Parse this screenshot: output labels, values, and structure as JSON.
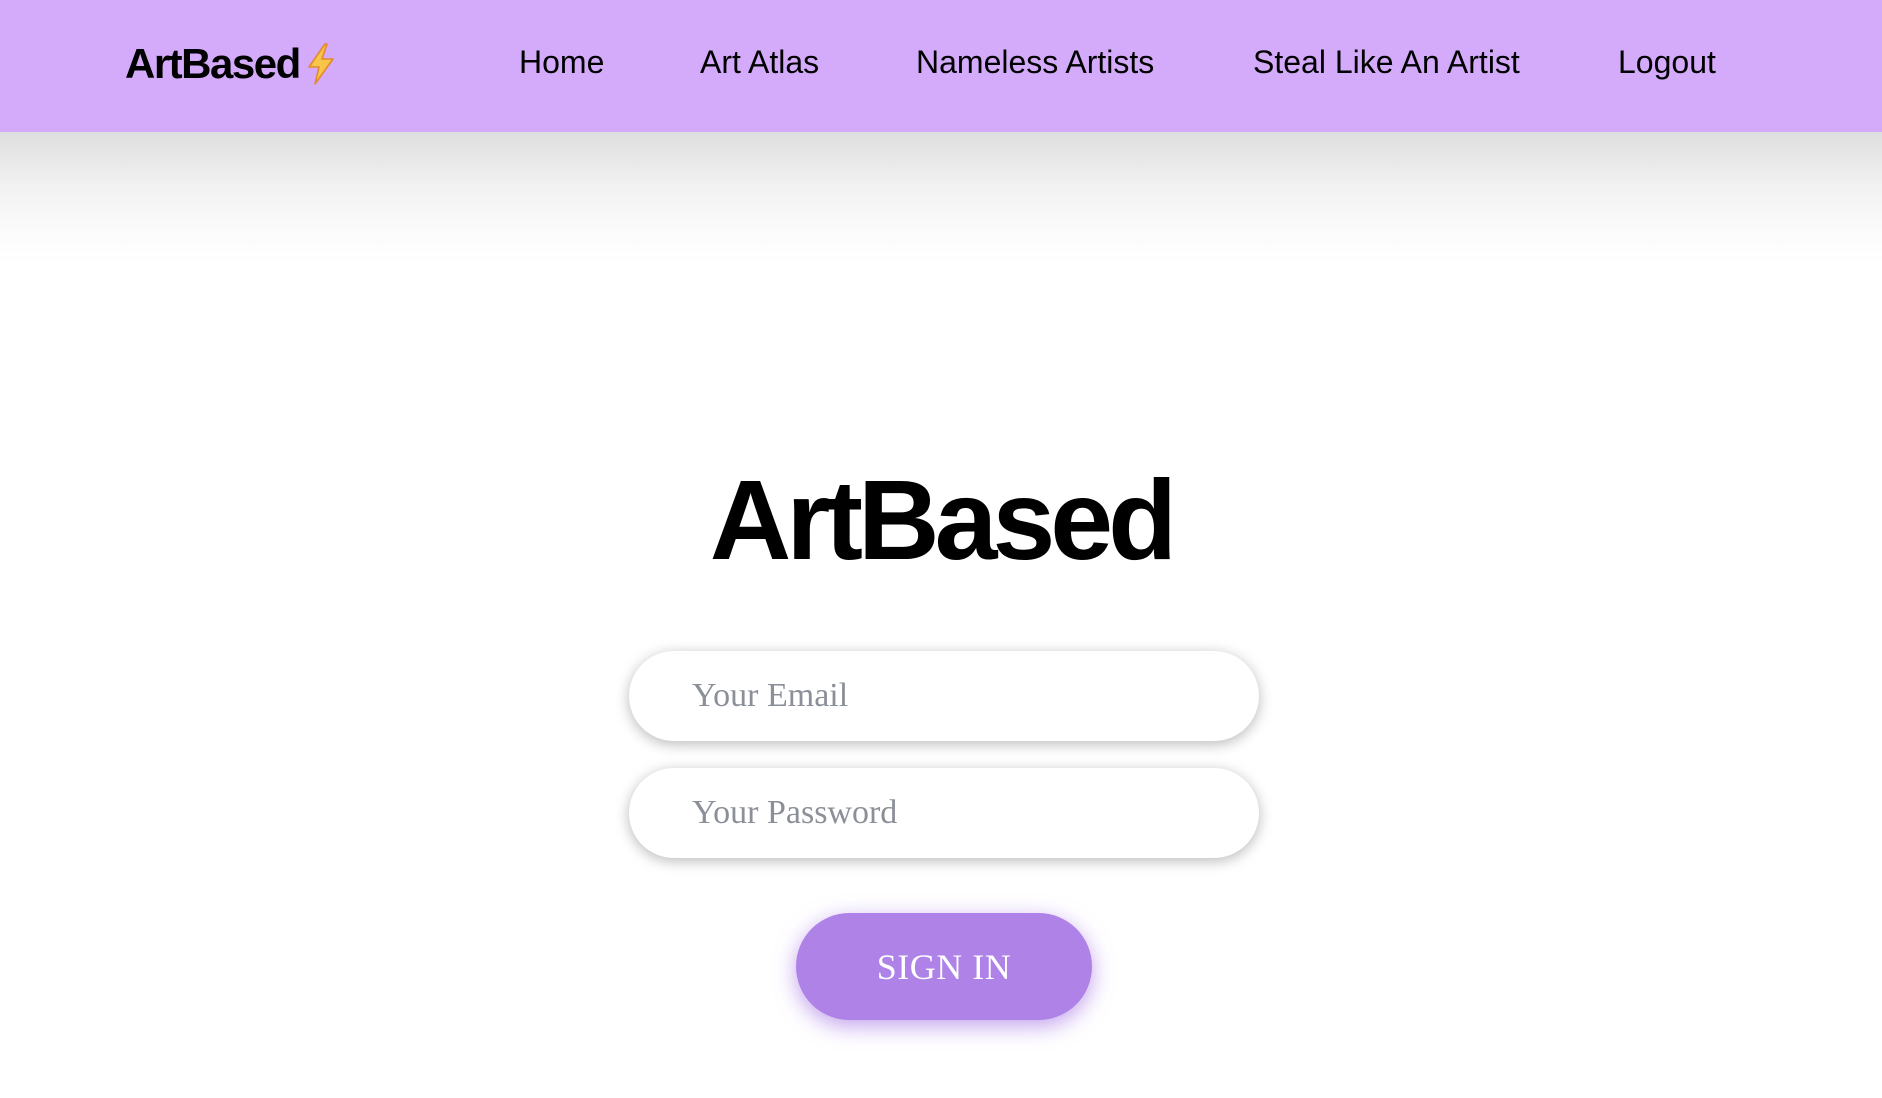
{
  "nav": {
    "brand": "ArtBased",
    "brand_icon": "lightning-bolt-icon",
    "links": [
      {
        "label": "Home"
      },
      {
        "label": "Art Atlas"
      },
      {
        "label": "Nameless Artists"
      },
      {
        "label": "Steal Like An Artist"
      },
      {
        "label": "Logout"
      }
    ]
  },
  "main": {
    "title": "ArtBased",
    "email_placeholder": "Your Email",
    "password_placeholder": "Your Password",
    "signin_label": "SIGN IN"
  },
  "colors": {
    "nav_background": "#d4aafb",
    "button_background": "#ae82e7",
    "button_text": "#ffffff",
    "placeholder_text": "#8a8f98",
    "bolt_fill": "#f7c548"
  }
}
